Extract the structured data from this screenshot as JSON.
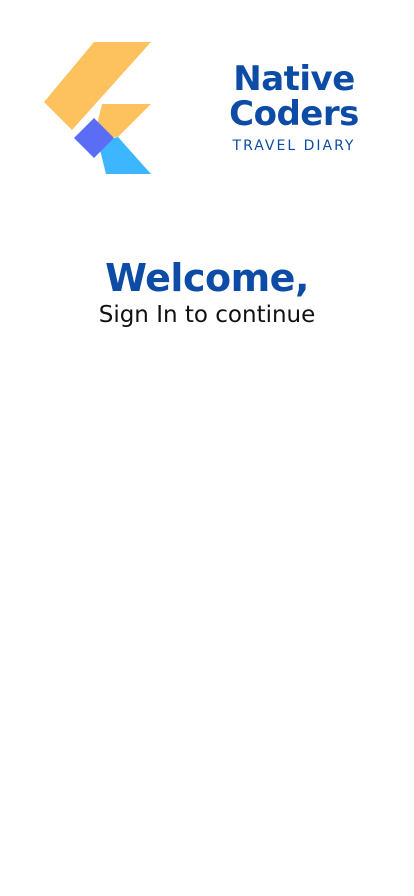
{
  "colors": {
    "primary": "#0d4ca6",
    "logo_orange": "#fdc15d",
    "logo_blue": "#3bb6ff",
    "logo_indigo": "#5b6cf5",
    "subtitle_text": "#111111"
  },
  "logo": {
    "icon": "native-coders-logo-icon",
    "brand_line1": "Native",
    "brand_line2": "Coders",
    "tagline": "TRAVEL DIARY"
  },
  "welcome": {
    "title": "Welcome,",
    "subtitle": "Sign In to continue"
  }
}
